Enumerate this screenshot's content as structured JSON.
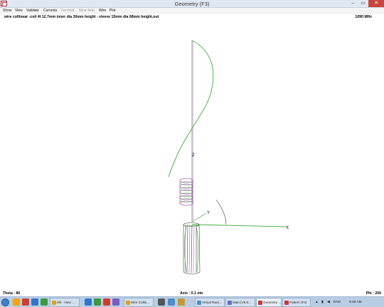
{
  "window": {
    "title": "Geometry     (F3)",
    "controls": {
      "minimize": "–",
      "maximize": "▭",
      "close": "✕"
    }
  },
  "menu": [
    {
      "label": "Show",
      "enabled": true
    },
    {
      "label": "View",
      "enabled": true
    },
    {
      "label": "Validate",
      "enabled": true
    },
    {
      "label": "Currents",
      "enabled": true
    },
    {
      "label": "Far-field",
      "enabled": false
    },
    {
      "label": "Near-field",
      "enabled": false
    },
    {
      "label": "Wire",
      "enabled": true
    },
    {
      "label": "Plot",
      "enabled": true
    }
  ],
  "info": {
    "filename": "wire collinear -coil 4t 12.7mm inner dia 30mm height - sleeve 15mm dia 68mm height.out",
    "frequency": "1090 MHz"
  },
  "plot": {
    "axis_labels": {
      "x": "X",
      "y": "Y",
      "z": "Z"
    },
    "colors": {
      "structure": "#8a8a8a",
      "coil": "#b05ab8",
      "current": "#3fae3f",
      "axis": "#2e9e2e",
      "sleeve": "#444444"
    }
  },
  "status": {
    "theta": "Theta : 80",
    "axis": "Axis : 0.1 mtr",
    "phi": "Phi : 200"
  },
  "taskbar": {
    "pinned_colors": [
      "#f7a400",
      "#d43b2a",
      "#2f77c8",
      "#3a9b3a"
    ],
    "tasks": [
      {
        "label": "eth - How ...",
        "icon_color": "#d9a21c",
        "active": false
      },
      {
        "label": "Wire Collin...",
        "icon_color": "#d9a21c",
        "active": false
      },
      {
        "label": "Virtual Radi...",
        "icon_color": "#4c8ccf",
        "active": false
      },
      {
        "label": "Main  [V5.8...",
        "icon_color": "#6b6bc8",
        "active": false
      },
      {
        "label": "Geometry ...",
        "icon_color": "#c83a3a",
        "active": true
      },
      {
        "label": "Pattern   (F4)",
        "icon_color": "#c83a3a",
        "active": false
      }
    ],
    "language": "ENG",
    "time": "9:48 AM"
  }
}
